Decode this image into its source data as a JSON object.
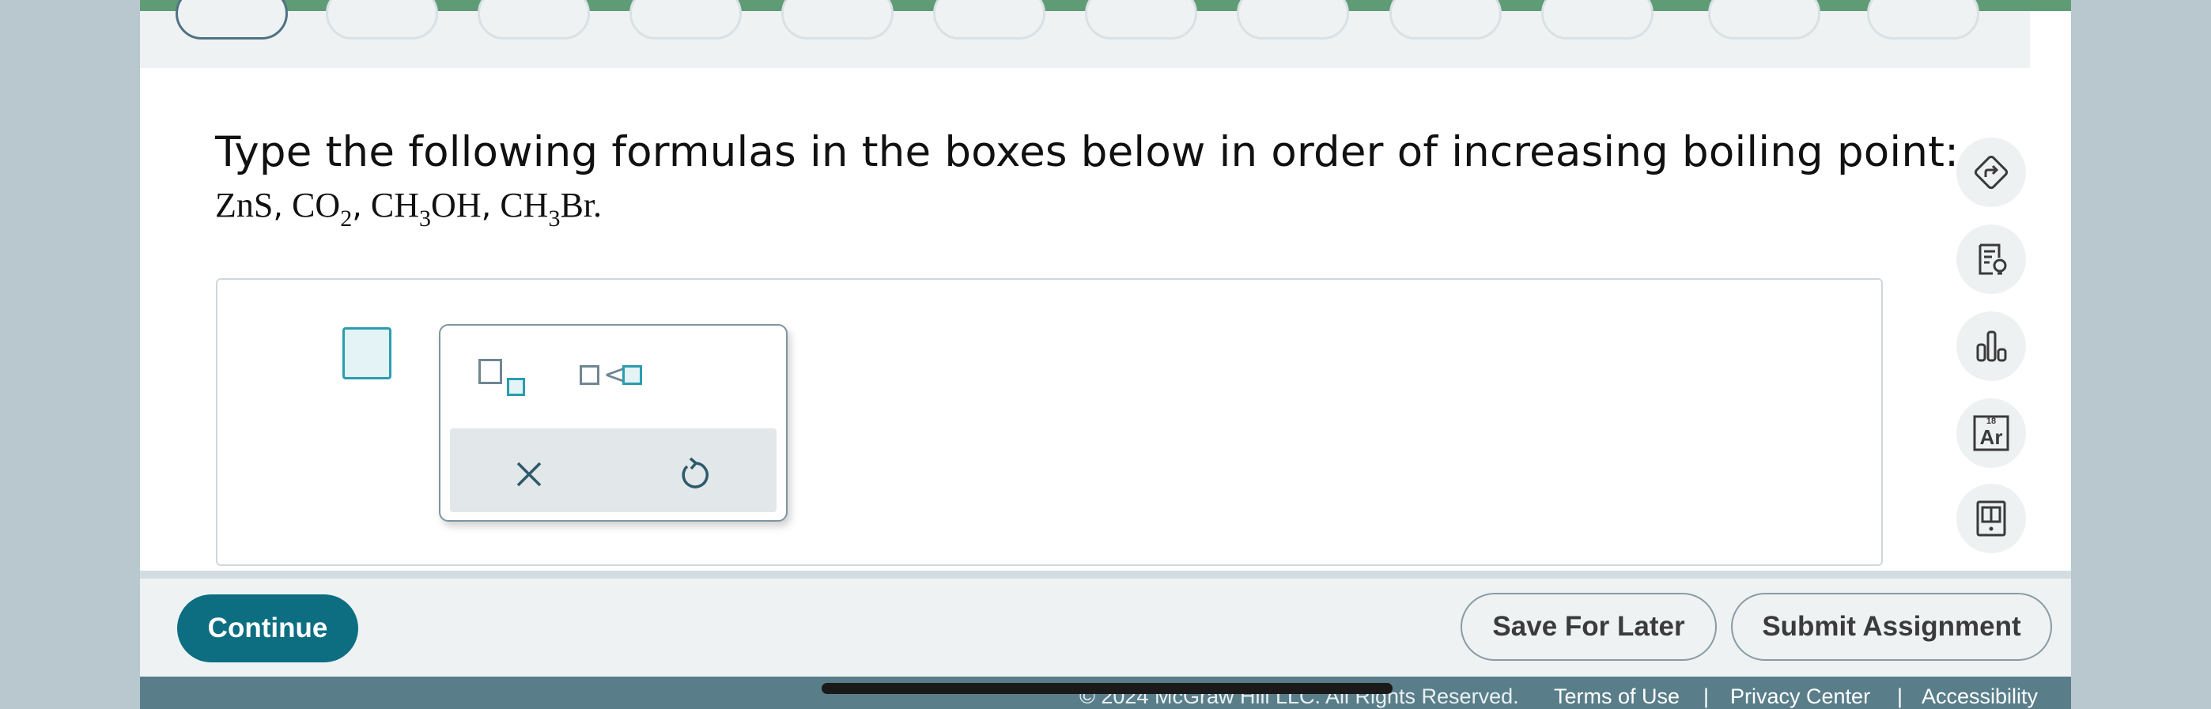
{
  "question": {
    "prompt": "Type the following formulas in the boxes below in order of increasing boiling point:",
    "formulas": [
      {
        "main": "ZnS",
        "sub1": "",
        "rest": ""
      },
      {
        "main": "CO",
        "sub1": "2",
        "rest": ""
      },
      {
        "main": "CH",
        "sub1": "3",
        "rest": "OH"
      },
      {
        "main": "CH",
        "sub1": "3",
        "rest": "Br"
      }
    ],
    "separator": ",",
    "end": "."
  },
  "palette": {
    "subscript_icon": "subscript-box-icon",
    "lessthan_icon": "less-than-boxes-icon",
    "lessthan_symbol": "<",
    "clear_icon": "x-icon",
    "undo_icon": "undo-icon"
  },
  "toolbar": {
    "icons": [
      "share-arrow-icon",
      "notes-lightbulb-icon",
      "bar-chart-icon",
      "periodic-table-icon",
      "textbook-icon"
    ],
    "periodic_number": "18",
    "periodic_symbol": "Ar"
  },
  "footer": {
    "continue_label": "Continue",
    "save_label": "Save For Later",
    "submit_label": "Submit Assignment"
  },
  "legal": {
    "copyright": "© 2024 McGraw Hill LLC. All Rights Reserved.",
    "terms": "Terms of Use",
    "privacy": "Privacy Center",
    "accessibility": "Accessibility",
    "pipe": "|"
  },
  "colors": {
    "accent": "#0d6e82",
    "progress_green": "#5f9c76",
    "input_teal": "#2a9db0",
    "legal_bar": "#597e8a"
  }
}
